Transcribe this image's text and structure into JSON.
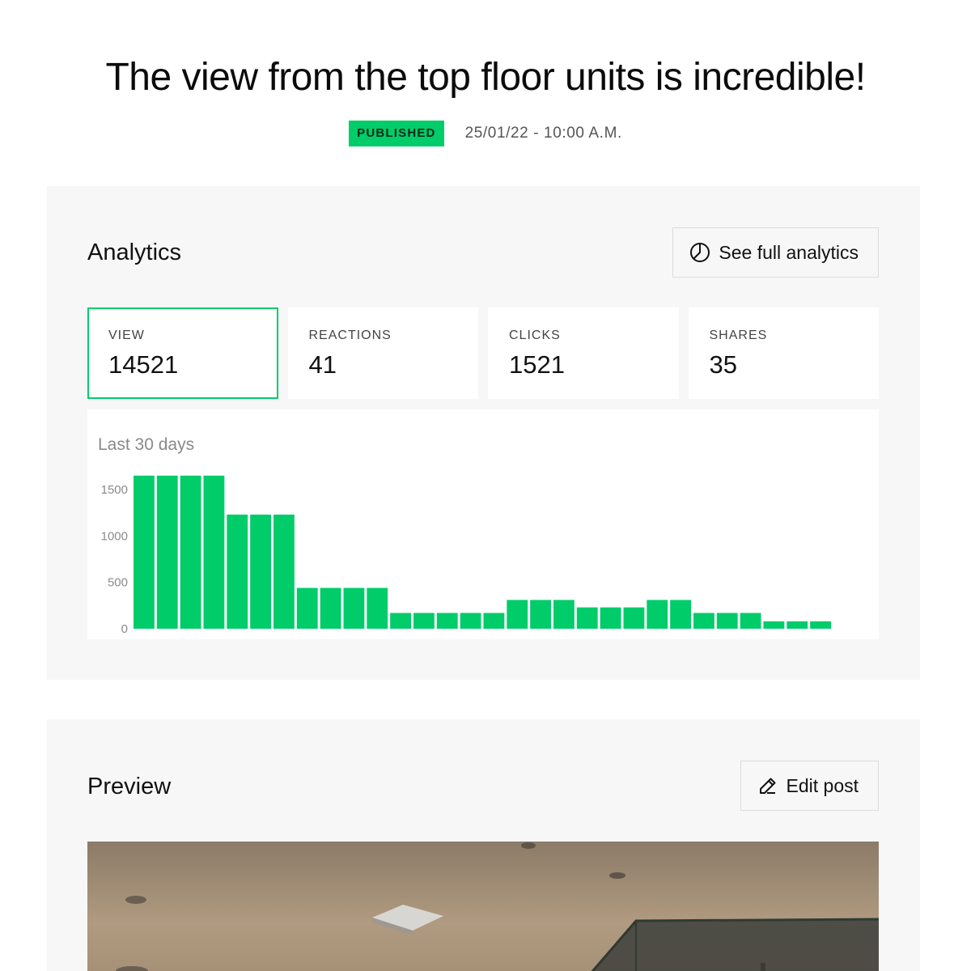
{
  "post": {
    "title": "The view from the top floor units is incredible!",
    "status": "PUBLISHED",
    "date": "25/01/22 - 10:00 A.M."
  },
  "colors": {
    "accent": "#00cc6a",
    "panel_bg": "#f7f7f7",
    "card_bg": "#ffffff"
  },
  "analytics": {
    "title": "Analytics",
    "full_button_label": "See full analytics",
    "full_button_icon": "pie-chart-icon",
    "stats": [
      {
        "label": "VIEW",
        "value": "14521",
        "active": true
      },
      {
        "label": "REACTIONS",
        "value": "41",
        "active": false
      },
      {
        "label": "CLICKS",
        "value": "1521",
        "active": false
      },
      {
        "label": "SHARES",
        "value": "35",
        "active": false
      }
    ],
    "chart_caption": "Last 30 days"
  },
  "chart_data": {
    "type": "bar",
    "title": "",
    "xlabel": "",
    "ylabel": "",
    "ylim": [
      0,
      1500
    ],
    "yticks": [
      0,
      500,
      1000,
      1500
    ],
    "grid": false,
    "values": [
      1650,
      1650,
      1650,
      1650,
      1230,
      1230,
      1230,
      440,
      440,
      440,
      440,
      170,
      170,
      170,
      170,
      170,
      310,
      310,
      310,
      230,
      230,
      230,
      310,
      310,
      170,
      170,
      170,
      80,
      80,
      80
    ]
  },
  "preview": {
    "title": "Preview",
    "edit_button_label": "Edit post",
    "edit_button_icon": "pencil-icon"
  }
}
